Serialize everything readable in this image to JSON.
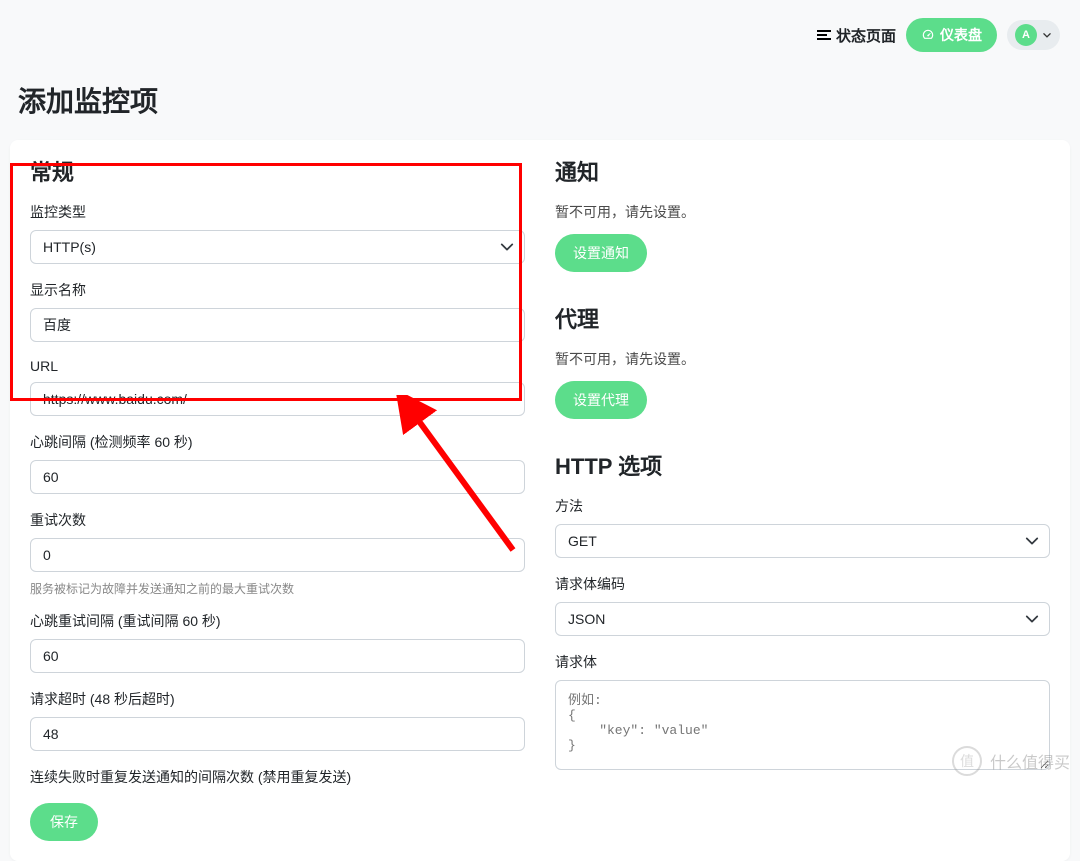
{
  "header": {
    "status_page": "状态页面",
    "dashboard": "仪表盘",
    "avatar": "A"
  },
  "page_title": "添加监控项",
  "left": {
    "section_general": "常规",
    "monitor_type_label": "监控类型",
    "monitor_type_value": "HTTP(s)",
    "display_name_label": "显示名称",
    "display_name_value": "百度",
    "url_label": "URL",
    "url_value": "https://www.baidu.com/",
    "heartbeat_label": "心跳间隔 (检测频率 60 秒)",
    "heartbeat_value": "60",
    "retries_label": "重试次数",
    "retries_value": "0",
    "retries_help": "服务被标记为故障并发送通知之前的最大重试次数",
    "retry_interval_label": "心跳重试间隔 (重试间隔 60 秒)",
    "retry_interval_value": "60",
    "timeout_label": "请求超时 (48 秒后超时)",
    "timeout_value": "48",
    "resend_label": "连续失败时重复发送通知的间隔次数 (禁用重复发送)",
    "save": "保存"
  },
  "right": {
    "section_notifications": "通知",
    "notif_unavailable": "暂不可用，请先设置。",
    "setup_notif": "设置通知",
    "section_proxy": "代理",
    "proxy_unavailable": "暂不可用，请先设置。",
    "setup_proxy": "设置代理",
    "section_http": "HTTP 选项",
    "method_label": "方法",
    "method_value": "GET",
    "body_encoding_label": "请求体编码",
    "body_encoding_value": "JSON",
    "body_label": "请求体",
    "body_placeholder": "例如:\n{\n    \"key\": \"value\"\n}"
  },
  "watermark": "什么值得买"
}
